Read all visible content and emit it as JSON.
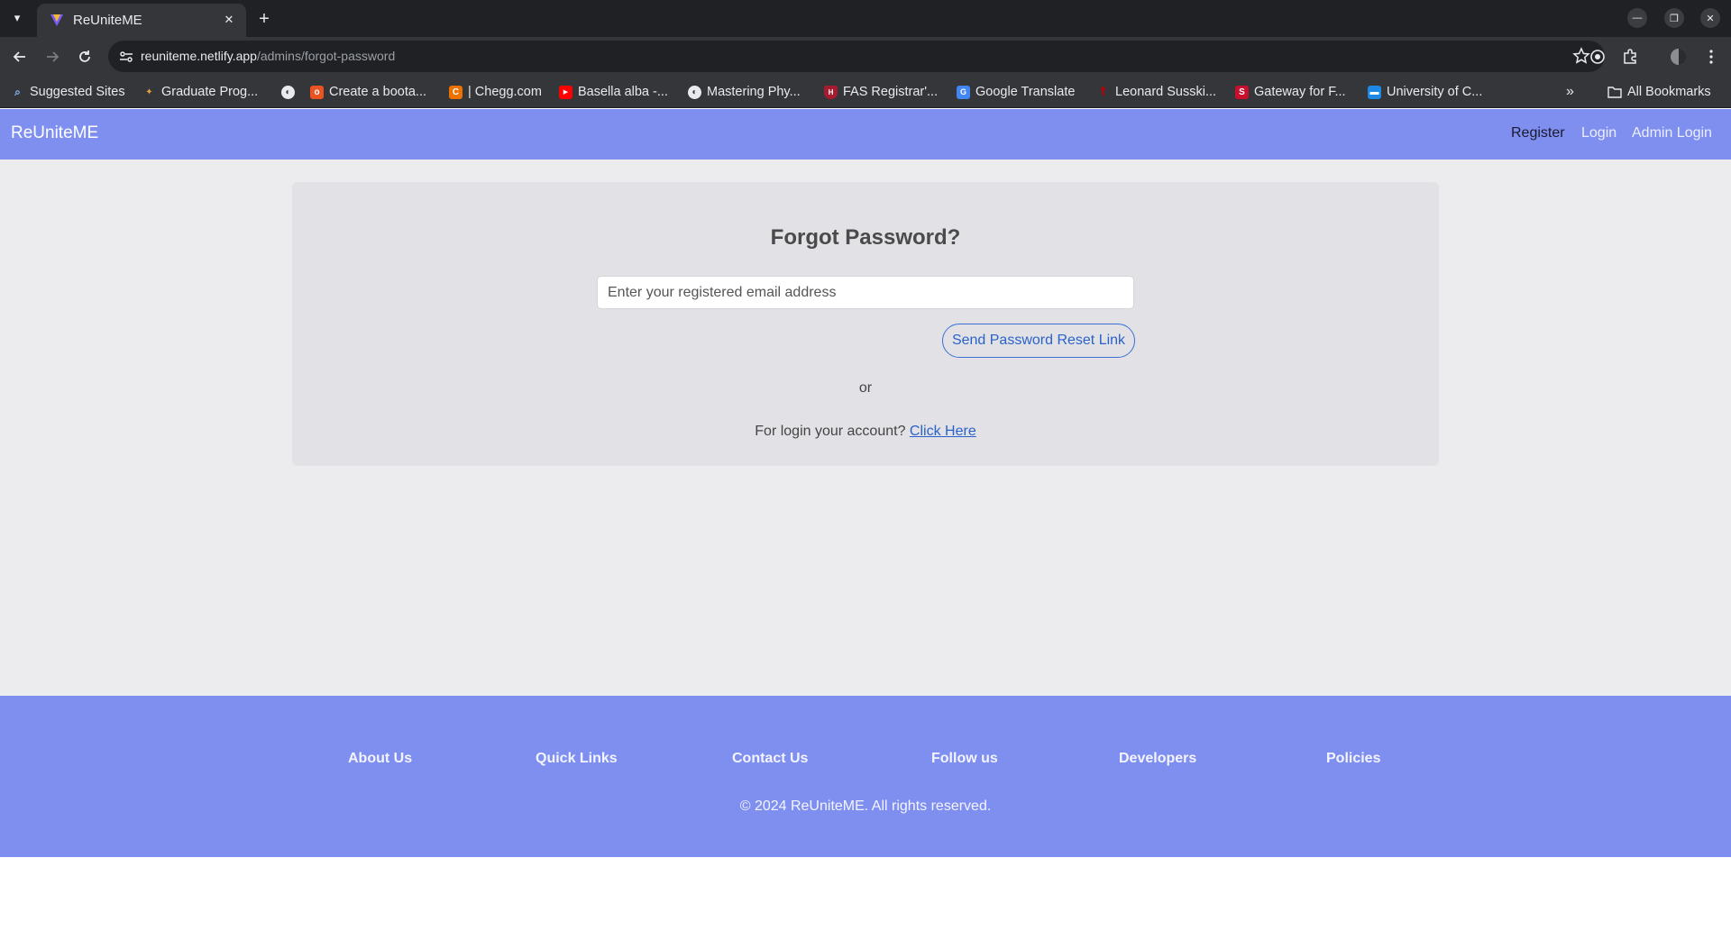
{
  "browser": {
    "tab_title": "ReUniteME",
    "url_host": "reuniteme.netlify.app",
    "url_path": "/admins/forgot-password",
    "bookmarks": [
      {
        "label": "Suggested Sites",
        "icon": "search-icon"
      },
      {
        "label": "Graduate Prog...",
        "icon": "graduate-icon"
      },
      {
        "label": "",
        "icon": "globe-icon"
      },
      {
        "label": "Create a boota...",
        "icon": "ubuntu-icon"
      },
      {
        "label": "| Chegg.com",
        "icon": "chegg-icon"
      },
      {
        "label": "Basella alba -...",
        "icon": "youtube-icon"
      },
      {
        "label": "Mastering Phy...",
        "icon": "globe-icon"
      },
      {
        "label": "FAS Registrar'...",
        "icon": "harvard-shield-icon"
      },
      {
        "label": "Google Translate",
        "icon": "google-translate-icon"
      },
      {
        "label": "Leonard Susski...",
        "icon": "stanford-icon"
      },
      {
        "label": "Gateway for F...",
        "icon": "gateway-icon"
      },
      {
        "label": "University of C...",
        "icon": "university-icon"
      }
    ],
    "all_bookmarks": "All Bookmarks"
  },
  "site": {
    "brand": "ReUniteME",
    "nav": {
      "register": "Register",
      "login": "Login",
      "admin_login": "Admin Login"
    }
  },
  "form": {
    "title": "Forgot Password?",
    "email_placeholder": "Enter your registered email address",
    "email_value": "",
    "submit_label": "Send Password Reset Link",
    "or_text": "or",
    "login_prompt": "For login your account?",
    "login_link": "Click Here"
  },
  "footer": {
    "links": [
      "About Us",
      "Quick Links",
      "Contact Us",
      "Follow us",
      "Developers",
      "Policies"
    ],
    "copyright": "© 2024 ReUniteME. All rights reserved."
  },
  "colors": {
    "navbar": "#7f8ff0",
    "page_bg": "#ececee",
    "card_bg": "#e2e2e6",
    "link_blue": "#2a62c9"
  }
}
